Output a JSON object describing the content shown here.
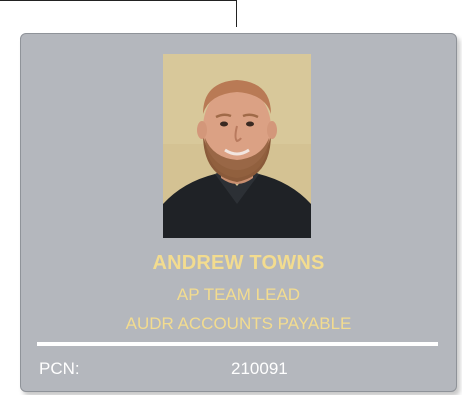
{
  "employee": {
    "name": "ANDREW TOWNS",
    "title": "AP TEAM LEAD",
    "department": "AUDR ACCOUNTS PAYABLE",
    "pcn_label": "PCN:",
    "pcn_value": "210091"
  },
  "colors": {
    "card_background": "#b4b7bd",
    "accent_text": "#f3dc8f",
    "divider": "#ffffff"
  }
}
